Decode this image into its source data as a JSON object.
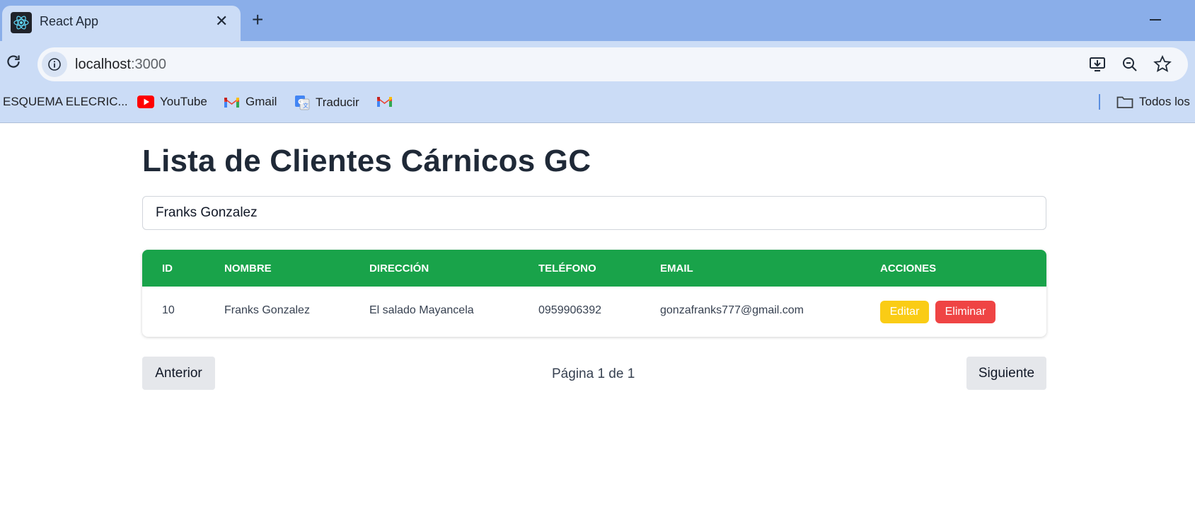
{
  "browser": {
    "tab_title": "React App",
    "tab_close": "✕",
    "new_tab": "+",
    "url_host": "localhost",
    "url_port": ":3000",
    "bookmarks": [
      {
        "label": "ESQUEMA ELECRIC...",
        "icon": "none"
      },
      {
        "label": "YouTube",
        "icon": "youtube-icon"
      },
      {
        "label": "Gmail",
        "icon": "gmail-icon"
      },
      {
        "label": "Traducir",
        "icon": "translate-icon"
      },
      {
        "label": "",
        "icon": "gmail-icon"
      }
    ],
    "all_bookmarks_label": "Todos los"
  },
  "page": {
    "title": "Lista de Clientes Cárnicos GC",
    "search_value": "Franks Gonzalez",
    "table": {
      "headers": [
        "ID",
        "NOMBRE",
        "DIRECCIÓN",
        "TELÉFONO",
        "EMAIL",
        "ACCIONES"
      ],
      "rows": [
        {
          "id": "10",
          "nombre": "Franks Gonzalez",
          "direccion": "El salado Mayancela",
          "telefono": "0959906392",
          "email": "gonzafranks777@gmail.com",
          "edit_label": "Editar",
          "delete_label": "Eliminar"
        }
      ]
    },
    "pagination": {
      "prev_label": "Anterior",
      "info": "Página 1 de 1",
      "next_label": "Siguiente"
    }
  },
  "colors": {
    "header_green": "#19a34a",
    "edit_yellow": "#facc15",
    "delete_red": "#ef4444",
    "chrome_blue": "#8aaee9"
  }
}
